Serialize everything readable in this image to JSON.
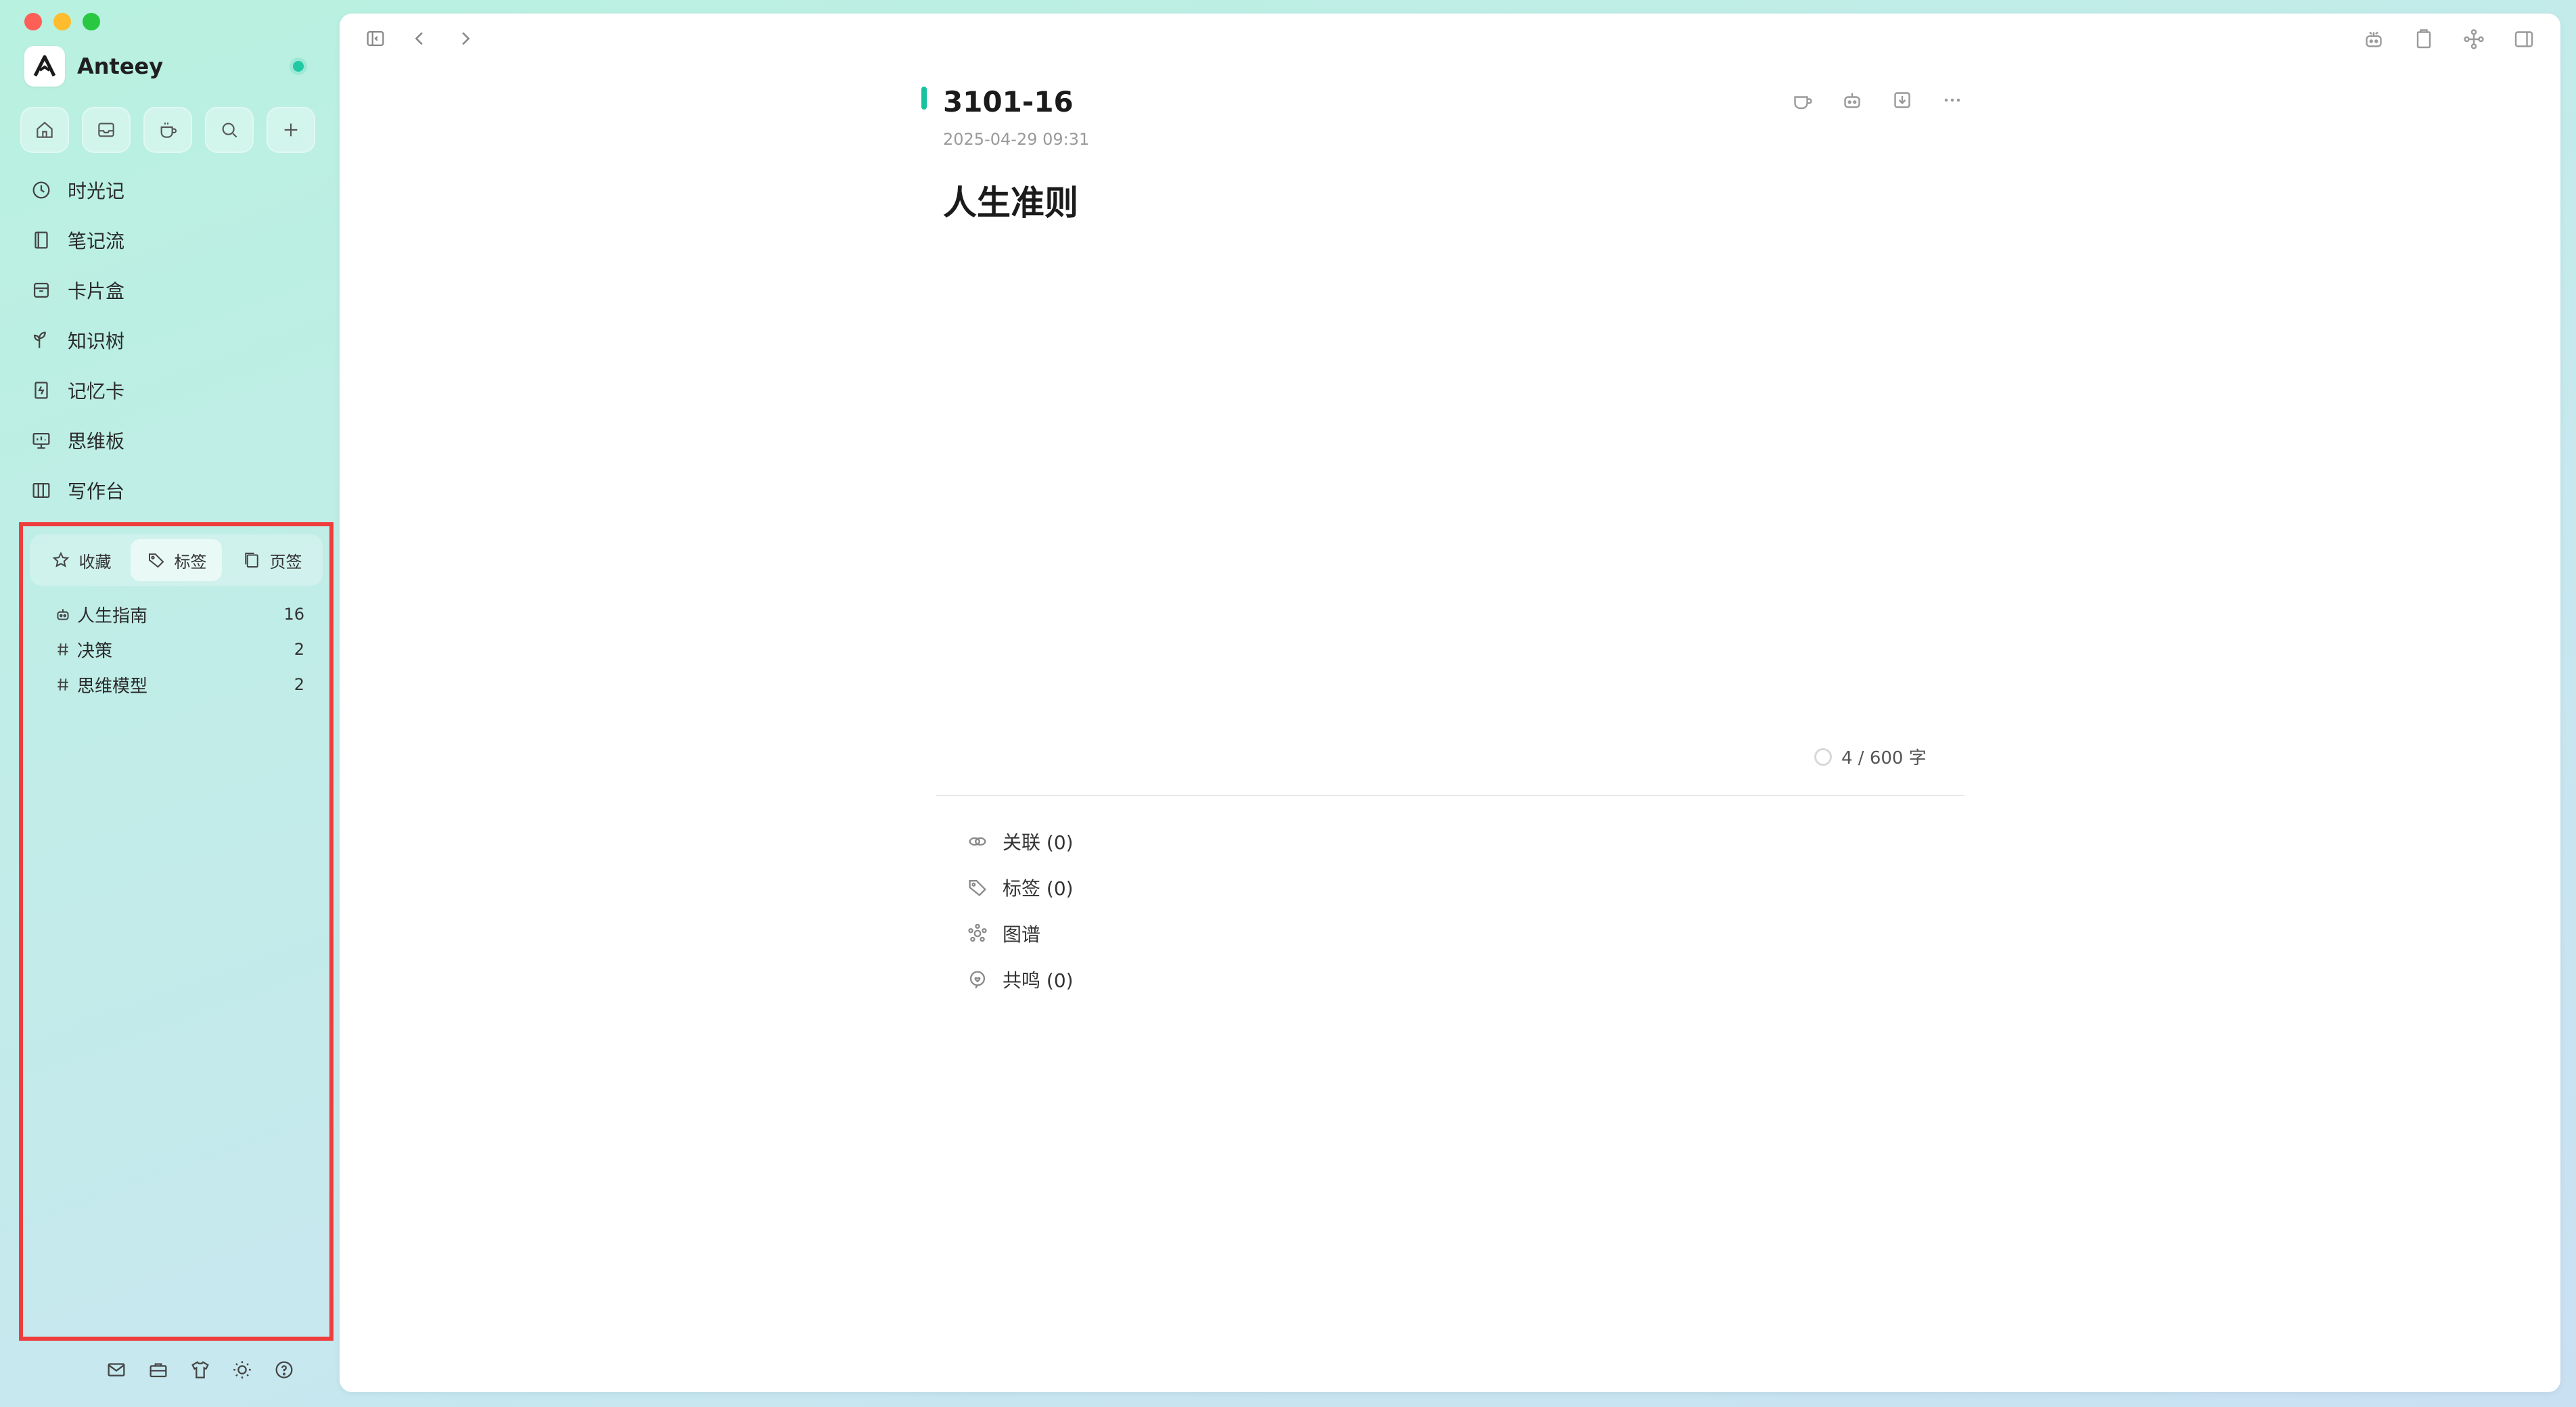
{
  "app": {
    "name": "Anteey"
  },
  "sidebar": {
    "nav": [
      {
        "label": "时光记",
        "icon": "clock-icon"
      },
      {
        "label": "笔记流",
        "icon": "notebook-icon"
      },
      {
        "label": "卡片盒",
        "icon": "archive-box-icon"
      },
      {
        "label": "知识树",
        "icon": "sprout-icon"
      },
      {
        "label": "记忆卡",
        "icon": "flashcard-icon"
      },
      {
        "label": "思维板",
        "icon": "presentation-board-icon"
      },
      {
        "label": "写作台",
        "icon": "writing-desk-icon"
      }
    ],
    "panel_tabs": [
      {
        "label": "收藏",
        "icon": "star-icon",
        "active": false
      },
      {
        "label": "标签",
        "icon": "tag-icon",
        "active": true
      },
      {
        "label": "页签",
        "icon": "pages-icon",
        "active": false
      }
    ],
    "tags": [
      {
        "name": "人生指南",
        "count": "16",
        "icon": "robot-tag-icon"
      },
      {
        "name": "决策",
        "count": "2",
        "icon": "hash-icon"
      },
      {
        "name": "思维模型",
        "count": "2",
        "icon": "hash-icon"
      }
    ]
  },
  "document": {
    "title": "3101-16",
    "date": "2025-04-29 09:31",
    "heading": "人生准则",
    "word_count": "4 / 600 字"
  },
  "meta_sections": [
    {
      "label": "关联 (0)",
      "icon": "link-icon"
    },
    {
      "label": "标签 (0)",
      "icon": "tag-icon"
    },
    {
      "label": "图谱",
      "icon": "graph-icon"
    },
    {
      "label": "共鸣 (0)",
      "icon": "resonance-icon"
    }
  ],
  "colors": {
    "accent": "#16c2a0",
    "highlight_border": "#ef3c3c"
  }
}
